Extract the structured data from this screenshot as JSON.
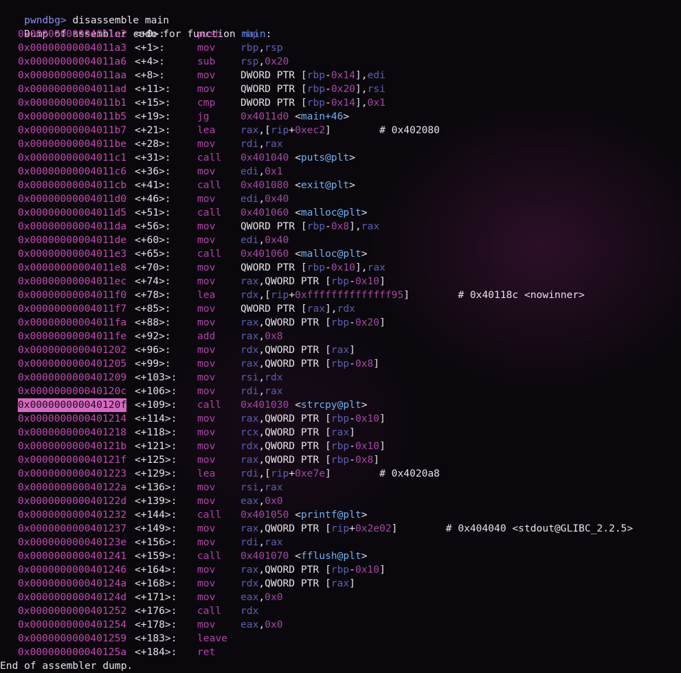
{
  "prompt": {
    "name": "pwndbg>",
    "command": " disassemble main"
  },
  "header": {
    "text": "Dump of assembler code for function ",
    "function": "main",
    "colon": ":"
  },
  "footer": "End of assembler dump.",
  "highlighted_address": "0x000000000040120f",
  "colors": {
    "address": "#c34ab0",
    "mnemonic": "#b044a8",
    "register": "#5c5fae",
    "number": "#a34aa3",
    "symbol": "#6fb0f2",
    "highlight": "#d66ac2",
    "prompt": "#8a8ff0"
  },
  "instructions": [
    {
      "addr": "0x00000000004011a2",
      "off": "<+0>:",
      "mn": "push",
      "ops": [
        [
          "rbp",
          "r"
        ]
      ]
    },
    {
      "addr": "0x00000000004011a3",
      "off": "<+1>:",
      "mn": "mov",
      "ops": [
        [
          "rbp",
          "r"
        ],
        [
          ",",
          "t"
        ],
        [
          "rsp",
          "r"
        ]
      ]
    },
    {
      "addr": "0x00000000004011a6",
      "off": "<+4>:",
      "mn": "sub",
      "ops": [
        [
          "rsp",
          "r"
        ],
        [
          ",",
          "t"
        ],
        [
          "0x20",
          "n"
        ]
      ]
    },
    {
      "addr": "0x00000000004011aa",
      "off": "<+8>:",
      "mn": "mov",
      "ops": [
        [
          "DWORD PTR [",
          "t"
        ],
        [
          "rbp",
          "r"
        ],
        [
          "-",
          "t"
        ],
        [
          "0x14",
          "n"
        ],
        [
          "],",
          "t"
        ],
        [
          "edi",
          "r"
        ]
      ]
    },
    {
      "addr": "0x00000000004011ad",
      "off": "<+11>:",
      "mn": "mov",
      "ops": [
        [
          "QWORD PTR [",
          "t"
        ],
        [
          "rbp",
          "r"
        ],
        [
          "-",
          "t"
        ],
        [
          "0x20",
          "n"
        ],
        [
          "],",
          "t"
        ],
        [
          "rsi",
          "r"
        ]
      ]
    },
    {
      "addr": "0x00000000004011b1",
      "off": "<+15>:",
      "mn": "cmp",
      "ops": [
        [
          "DWORD PTR [",
          "t"
        ],
        [
          "rbp",
          "r"
        ],
        [
          "-",
          "t"
        ],
        [
          "0x14",
          "n"
        ],
        [
          "],",
          "t"
        ],
        [
          "0x1",
          "n"
        ]
      ]
    },
    {
      "addr": "0x00000000004011b5",
      "off": "<+19>:",
      "mn": "jg",
      "ops": [
        [
          "0x4011d0",
          "n"
        ],
        [
          " <",
          "t"
        ],
        [
          "main+46",
          "s"
        ],
        [
          ">",
          "t"
        ]
      ]
    },
    {
      "addr": "0x00000000004011b7",
      "off": "<+21>:",
      "mn": "lea",
      "ops": [
        [
          "rax",
          "r"
        ],
        [
          ",[",
          "t"
        ],
        [
          "rip",
          "r"
        ],
        [
          "+",
          "t"
        ],
        [
          "0xec2",
          "n"
        ],
        [
          "]        # 0x402080",
          "t"
        ]
      ]
    },
    {
      "addr": "0x00000000004011be",
      "off": "<+28>:",
      "mn": "mov",
      "ops": [
        [
          "rdi",
          "r"
        ],
        [
          ",",
          "t"
        ],
        [
          "rax",
          "r"
        ]
      ]
    },
    {
      "addr": "0x00000000004011c1",
      "off": "<+31>:",
      "mn": "call",
      "ops": [
        [
          "0x401040",
          "n"
        ],
        [
          " <",
          "t"
        ],
        [
          "puts@plt",
          "s"
        ],
        [
          ">",
          "t"
        ]
      ]
    },
    {
      "addr": "0x00000000004011c6",
      "off": "<+36>:",
      "mn": "mov",
      "ops": [
        [
          "edi",
          "r"
        ],
        [
          ",",
          "t"
        ],
        [
          "0x1",
          "n"
        ]
      ]
    },
    {
      "addr": "0x00000000004011cb",
      "off": "<+41>:",
      "mn": "call",
      "ops": [
        [
          "0x401080",
          "n"
        ],
        [
          " <",
          "t"
        ],
        [
          "exit@plt",
          "s"
        ],
        [
          ">",
          "t"
        ]
      ]
    },
    {
      "addr": "0x00000000004011d0",
      "off": "<+46>:",
      "mn": "mov",
      "ops": [
        [
          "edi",
          "r"
        ],
        [
          ",",
          "t"
        ],
        [
          "0x40",
          "n"
        ]
      ]
    },
    {
      "addr": "0x00000000004011d5",
      "off": "<+51>:",
      "mn": "call",
      "ops": [
        [
          "0x401060",
          "n"
        ],
        [
          " <",
          "t"
        ],
        [
          "malloc@plt",
          "s"
        ],
        [
          ">",
          "t"
        ]
      ]
    },
    {
      "addr": "0x00000000004011da",
      "off": "<+56>:",
      "mn": "mov",
      "ops": [
        [
          "QWORD PTR [",
          "t"
        ],
        [
          "rbp",
          "r"
        ],
        [
          "-",
          "t"
        ],
        [
          "0x8",
          "n"
        ],
        [
          "],",
          "t"
        ],
        [
          "rax",
          "r"
        ]
      ]
    },
    {
      "addr": "0x00000000004011de",
      "off": "<+60>:",
      "mn": "mov",
      "ops": [
        [
          "edi",
          "r"
        ],
        [
          ",",
          "t"
        ],
        [
          "0x40",
          "n"
        ]
      ]
    },
    {
      "addr": "0x00000000004011e3",
      "off": "<+65>:",
      "mn": "call",
      "ops": [
        [
          "0x401060",
          "n"
        ],
        [
          " <",
          "t"
        ],
        [
          "malloc@plt",
          "s"
        ],
        [
          ">",
          "t"
        ]
      ]
    },
    {
      "addr": "0x00000000004011e8",
      "off": "<+70>:",
      "mn": "mov",
      "ops": [
        [
          "QWORD PTR [",
          "t"
        ],
        [
          "rbp",
          "r"
        ],
        [
          "-",
          "t"
        ],
        [
          "0x10",
          "n"
        ],
        [
          "],",
          "t"
        ],
        [
          "rax",
          "r"
        ]
      ]
    },
    {
      "addr": "0x00000000004011ec",
      "off": "<+74>:",
      "mn": "mov",
      "ops": [
        [
          "rax",
          "r"
        ],
        [
          ",QWORD PTR [",
          "t"
        ],
        [
          "rbp",
          "r"
        ],
        [
          "-",
          "t"
        ],
        [
          "0x10",
          "n"
        ],
        [
          "]",
          "t"
        ]
      ]
    },
    {
      "addr": "0x00000000004011f0",
      "off": "<+78>:",
      "mn": "lea",
      "ops": [
        [
          "rdx",
          "r"
        ],
        [
          ",[",
          "t"
        ],
        [
          "rip",
          "r"
        ],
        [
          "+",
          "t"
        ],
        [
          "0xffffffffffffff95",
          "n"
        ],
        [
          "]        # 0x40118c <nowinner>",
          "t"
        ]
      ]
    },
    {
      "addr": "0x00000000004011f7",
      "off": "<+85>:",
      "mn": "mov",
      "ops": [
        [
          "QWORD PTR [",
          "t"
        ],
        [
          "rax",
          "r"
        ],
        [
          "],",
          "t"
        ],
        [
          "rdx",
          "r"
        ]
      ]
    },
    {
      "addr": "0x00000000004011fa",
      "off": "<+88>:",
      "mn": "mov",
      "ops": [
        [
          "rax",
          "r"
        ],
        [
          ",QWORD PTR [",
          "t"
        ],
        [
          "rbp",
          "r"
        ],
        [
          "-",
          "t"
        ],
        [
          "0x20",
          "n"
        ],
        [
          "]",
          "t"
        ]
      ]
    },
    {
      "addr": "0x00000000004011fe",
      "off": "<+92>:",
      "mn": "add",
      "ops": [
        [
          "rax",
          "r"
        ],
        [
          ",",
          "t"
        ],
        [
          "0x8",
          "n"
        ]
      ]
    },
    {
      "addr": "0x0000000000401202",
      "off": "<+96>:",
      "mn": "mov",
      "ops": [
        [
          "rdx",
          "r"
        ],
        [
          ",QWORD PTR [",
          "t"
        ],
        [
          "rax",
          "r"
        ],
        [
          "]",
          "t"
        ]
      ]
    },
    {
      "addr": "0x0000000000401205",
      "off": "<+99>:",
      "mn": "mov",
      "ops": [
        [
          "rax",
          "r"
        ],
        [
          ",QWORD PTR [",
          "t"
        ],
        [
          "rbp",
          "r"
        ],
        [
          "-",
          "t"
        ],
        [
          "0x8",
          "n"
        ],
        [
          "]",
          "t"
        ]
      ]
    },
    {
      "addr": "0x0000000000401209",
      "off": "<+103>:",
      "mn": "mov",
      "ops": [
        [
          "rsi",
          "r"
        ],
        [
          ",",
          "t"
        ],
        [
          "rdx",
          "r"
        ]
      ]
    },
    {
      "addr": "0x000000000040120c",
      "off": "<+106>:",
      "mn": "mov",
      "ops": [
        [
          "rdi",
          "r"
        ],
        [
          ",",
          "t"
        ],
        [
          "rax",
          "r"
        ]
      ]
    },
    {
      "addr": "0x000000000040120f",
      "off": "<+109>:",
      "mn": "call",
      "ops": [
        [
          "0x401030",
          "n"
        ],
        [
          " <",
          "t"
        ],
        [
          "strcpy@plt",
          "s"
        ],
        [
          ">",
          "t"
        ]
      ]
    },
    {
      "addr": "0x0000000000401214",
      "off": "<+114>:",
      "mn": "mov",
      "ops": [
        [
          "rax",
          "r"
        ],
        [
          ",QWORD PTR [",
          "t"
        ],
        [
          "rbp",
          "r"
        ],
        [
          "-",
          "t"
        ],
        [
          "0x10",
          "n"
        ],
        [
          "]",
          "t"
        ]
      ]
    },
    {
      "addr": "0x0000000000401218",
      "off": "<+118>:",
      "mn": "mov",
      "ops": [
        [
          "rcx",
          "r"
        ],
        [
          ",QWORD PTR [",
          "t"
        ],
        [
          "rax",
          "r"
        ],
        [
          "]",
          "t"
        ]
      ]
    },
    {
      "addr": "0x000000000040121b",
      "off": "<+121>:",
      "mn": "mov",
      "ops": [
        [
          "rdx",
          "r"
        ],
        [
          ",QWORD PTR [",
          "t"
        ],
        [
          "rbp",
          "r"
        ],
        [
          "-",
          "t"
        ],
        [
          "0x10",
          "n"
        ],
        [
          "]",
          "t"
        ]
      ]
    },
    {
      "addr": "0x000000000040121f",
      "off": "<+125>:",
      "mn": "mov",
      "ops": [
        [
          "rax",
          "r"
        ],
        [
          ",QWORD PTR [",
          "t"
        ],
        [
          "rbp",
          "r"
        ],
        [
          "-",
          "t"
        ],
        [
          "0x8",
          "n"
        ],
        [
          "]",
          "t"
        ]
      ]
    },
    {
      "addr": "0x0000000000401223",
      "off": "<+129>:",
      "mn": "lea",
      "ops": [
        [
          "rdi",
          "r"
        ],
        [
          ",[",
          "t"
        ],
        [
          "rip",
          "r"
        ],
        [
          "+",
          "t"
        ],
        [
          "0xe7e",
          "n"
        ],
        [
          "]        # 0x4020a8",
          "t"
        ]
      ]
    },
    {
      "addr": "0x000000000040122a",
      "off": "<+136>:",
      "mn": "mov",
      "ops": [
        [
          "rsi",
          "r"
        ],
        [
          ",",
          "t"
        ],
        [
          "rax",
          "r"
        ]
      ]
    },
    {
      "addr": "0x000000000040122d",
      "off": "<+139>:",
      "mn": "mov",
      "ops": [
        [
          "eax",
          "r"
        ],
        [
          ",",
          "t"
        ],
        [
          "0x0",
          "n"
        ]
      ]
    },
    {
      "addr": "0x0000000000401232",
      "off": "<+144>:",
      "mn": "call",
      "ops": [
        [
          "0x401050",
          "n"
        ],
        [
          " <",
          "t"
        ],
        [
          "printf@plt",
          "s"
        ],
        [
          ">",
          "t"
        ]
      ]
    },
    {
      "addr": "0x0000000000401237",
      "off": "<+149>:",
      "mn": "mov",
      "ops": [
        [
          "rax",
          "r"
        ],
        [
          ",QWORD PTR [",
          "t"
        ],
        [
          "rip",
          "r"
        ],
        [
          "+",
          "t"
        ],
        [
          "0x2e02",
          "n"
        ],
        [
          "]        # 0x404040 <stdout@GLIBC_2.2.5>",
          "t"
        ]
      ]
    },
    {
      "addr": "0x000000000040123e",
      "off": "<+156>:",
      "mn": "mov",
      "ops": [
        [
          "rdi",
          "r"
        ],
        [
          ",",
          "t"
        ],
        [
          "rax",
          "r"
        ]
      ]
    },
    {
      "addr": "0x0000000000401241",
      "off": "<+159>:",
      "mn": "call",
      "ops": [
        [
          "0x401070",
          "n"
        ],
        [
          " <",
          "t"
        ],
        [
          "fflush@plt",
          "s"
        ],
        [
          ">",
          "t"
        ]
      ]
    },
    {
      "addr": "0x0000000000401246",
      "off": "<+164>:",
      "mn": "mov",
      "ops": [
        [
          "rax",
          "r"
        ],
        [
          ",QWORD PTR [",
          "t"
        ],
        [
          "rbp",
          "r"
        ],
        [
          "-",
          "t"
        ],
        [
          "0x10",
          "n"
        ],
        [
          "]",
          "t"
        ]
      ]
    },
    {
      "addr": "0x000000000040124a",
      "off": "<+168>:",
      "mn": "mov",
      "ops": [
        [
          "rdx",
          "r"
        ],
        [
          ",QWORD PTR [",
          "t"
        ],
        [
          "rax",
          "r"
        ],
        [
          "]",
          "t"
        ]
      ]
    },
    {
      "addr": "0x000000000040124d",
      "off": "<+171>:",
      "mn": "mov",
      "ops": [
        [
          "eax",
          "r"
        ],
        [
          ",",
          "t"
        ],
        [
          "0x0",
          "n"
        ]
      ]
    },
    {
      "addr": "0x0000000000401252",
      "off": "<+176>:",
      "mn": "call",
      "ops": [
        [
          "rdx",
          "r"
        ]
      ]
    },
    {
      "addr": "0x0000000000401254",
      "off": "<+178>:",
      "mn": "mov",
      "ops": [
        [
          "eax",
          "r"
        ],
        [
          ",",
          "t"
        ],
        [
          "0x0",
          "n"
        ]
      ]
    },
    {
      "addr": "0x0000000000401259",
      "off": "<+183>:",
      "mn": "leave",
      "ops": []
    },
    {
      "addr": "0x000000000040125a",
      "off": "<+184>:",
      "mn": "ret",
      "ops": []
    }
  ]
}
